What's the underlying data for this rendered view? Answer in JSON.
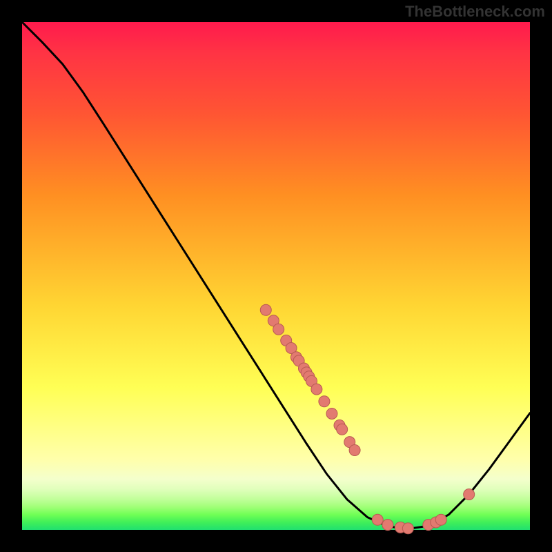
{
  "watermark": "TheBottleneck.com",
  "chart_data": {
    "type": "line",
    "title": "",
    "xlabel": "",
    "ylabel": "",
    "xlim": [
      0,
      1
    ],
    "ylim": [
      0,
      1
    ],
    "curve": [
      {
        "x": 0.0,
        "y": 1.0
      },
      {
        "x": 0.04,
        "y": 0.96
      },
      {
        "x": 0.08,
        "y": 0.917
      },
      {
        "x": 0.12,
        "y": 0.862
      },
      {
        "x": 0.16,
        "y": 0.8
      },
      {
        "x": 0.2,
        "y": 0.737
      },
      {
        "x": 0.24,
        "y": 0.674
      },
      {
        "x": 0.28,
        "y": 0.611
      },
      {
        "x": 0.32,
        "y": 0.548
      },
      {
        "x": 0.36,
        "y": 0.485
      },
      {
        "x": 0.4,
        "y": 0.422
      },
      {
        "x": 0.44,
        "y": 0.359
      },
      {
        "x": 0.48,
        "y": 0.296
      },
      {
        "x": 0.52,
        "y": 0.233
      },
      {
        "x": 0.56,
        "y": 0.17
      },
      {
        "x": 0.6,
        "y": 0.11
      },
      {
        "x": 0.64,
        "y": 0.06
      },
      {
        "x": 0.68,
        "y": 0.025
      },
      {
        "x": 0.72,
        "y": 0.007
      },
      {
        "x": 0.76,
        "y": 0.002
      },
      {
        "x": 0.8,
        "y": 0.008
      },
      {
        "x": 0.84,
        "y": 0.03
      },
      {
        "x": 0.88,
        "y": 0.07
      },
      {
        "x": 0.92,
        "y": 0.12
      },
      {
        "x": 0.96,
        "y": 0.175
      },
      {
        "x": 1.0,
        "y": 0.23
      }
    ],
    "markers": [
      {
        "x": 0.48,
        "y": 0.433
      },
      {
        "x": 0.495,
        "y": 0.412
      },
      {
        "x": 0.505,
        "y": 0.395
      },
      {
        "x": 0.52,
        "y": 0.373
      },
      {
        "x": 0.53,
        "y": 0.358
      },
      {
        "x": 0.54,
        "y": 0.34
      },
      {
        "x": 0.545,
        "y": 0.333
      },
      {
        "x": 0.555,
        "y": 0.318
      },
      {
        "x": 0.56,
        "y": 0.31
      },
      {
        "x": 0.565,
        "y": 0.302
      },
      {
        "x": 0.57,
        "y": 0.293
      },
      {
        "x": 0.58,
        "y": 0.277
      },
      {
        "x": 0.595,
        "y": 0.253
      },
      {
        "x": 0.61,
        "y": 0.229
      },
      {
        "x": 0.625,
        "y": 0.206
      },
      {
        "x": 0.63,
        "y": 0.198
      },
      {
        "x": 0.645,
        "y": 0.173
      },
      {
        "x": 0.655,
        "y": 0.157
      },
      {
        "x": 0.7,
        "y": 0.02
      },
      {
        "x": 0.72,
        "y": 0.01
      },
      {
        "x": 0.745,
        "y": 0.005
      },
      {
        "x": 0.76,
        "y": 0.003
      },
      {
        "x": 0.8,
        "y": 0.01
      },
      {
        "x": 0.815,
        "y": 0.015
      },
      {
        "x": 0.825,
        "y": 0.02
      },
      {
        "x": 0.88,
        "y": 0.07
      }
    ],
    "colors": {
      "curve": "#000000",
      "marker_fill": "#e27a70",
      "marker_stroke": "#b85a52"
    }
  }
}
